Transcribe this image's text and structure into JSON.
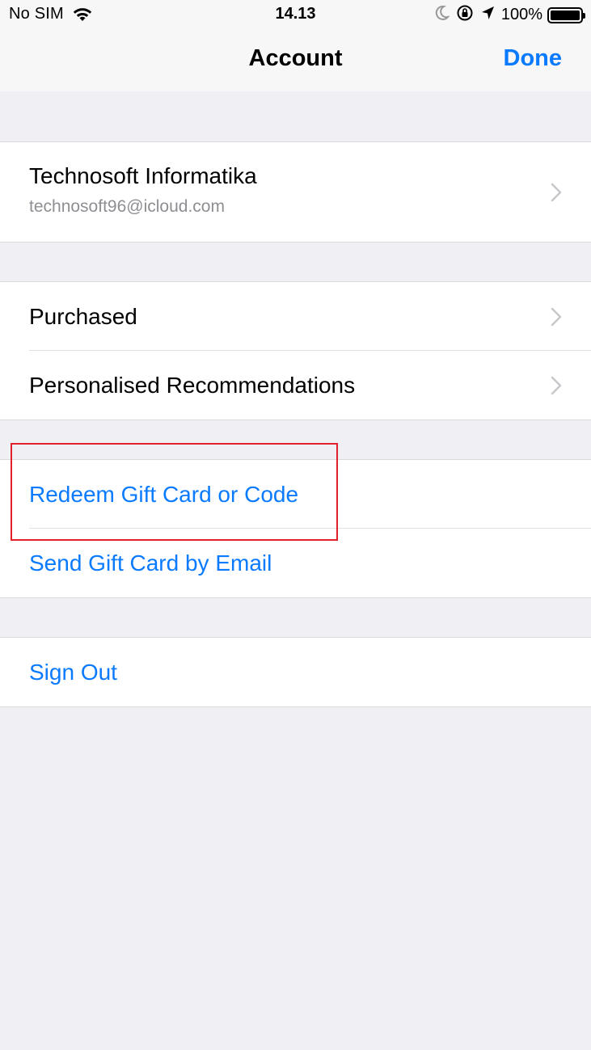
{
  "status_bar": {
    "carrier": "No SIM",
    "time": "14.13",
    "battery_percent": "100%",
    "icons": [
      "wifi-icon",
      "moon-icon",
      "orientation-lock-icon",
      "location-arrow-icon",
      "battery-icon"
    ]
  },
  "nav": {
    "title": "Account",
    "done_label": "Done"
  },
  "account": {
    "name": "Technosoft Informatika",
    "email": "technosoft96@icloud.com"
  },
  "menu": {
    "purchased": "Purchased",
    "recommendations": "Personalised Recommendations"
  },
  "gift": {
    "redeem": "Redeem Gift Card or Code",
    "send": "Send Gift Card by Email"
  },
  "signout": {
    "label": "Sign Out"
  },
  "colors": {
    "accent": "#0a7aff",
    "background": "#efeff4",
    "highlight": "#e0202a"
  }
}
